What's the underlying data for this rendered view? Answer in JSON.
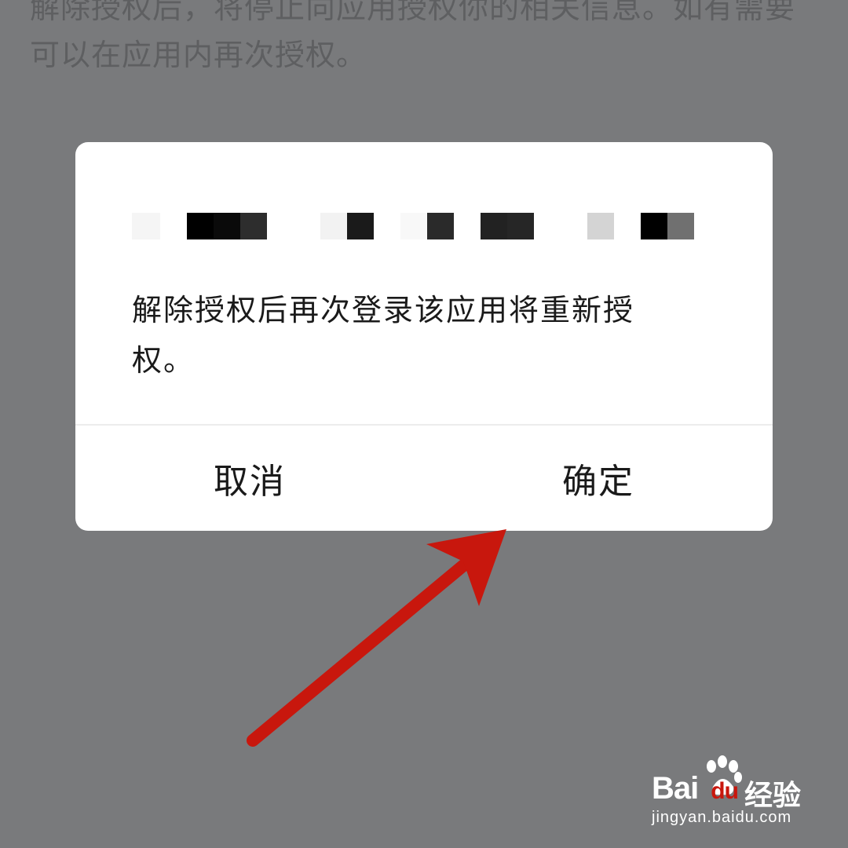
{
  "background": {
    "line1": "解除授权后，将停止向应用授权你的相关信息。如有需要",
    "line2": "可以在应用内再次授权。"
  },
  "dialog": {
    "title_redacted": true,
    "message_line1": "解除授权后再次登录该应用将重新授",
    "message_line2": "权。",
    "cancel_label": "取消",
    "confirm_label": "确定"
  },
  "annotation": {
    "arrow_color": "#c8170d",
    "arrow_target": "confirm-button"
  },
  "watermark": {
    "brand": "Bai",
    "brand_mid": "du",
    "suffix": "经验",
    "url": "jingyan.baidu.com"
  },
  "colors": {
    "overlay": "#797a7c",
    "dialog_bg": "#ffffff",
    "text": "#1a1a1a",
    "divider": "#ececec"
  }
}
